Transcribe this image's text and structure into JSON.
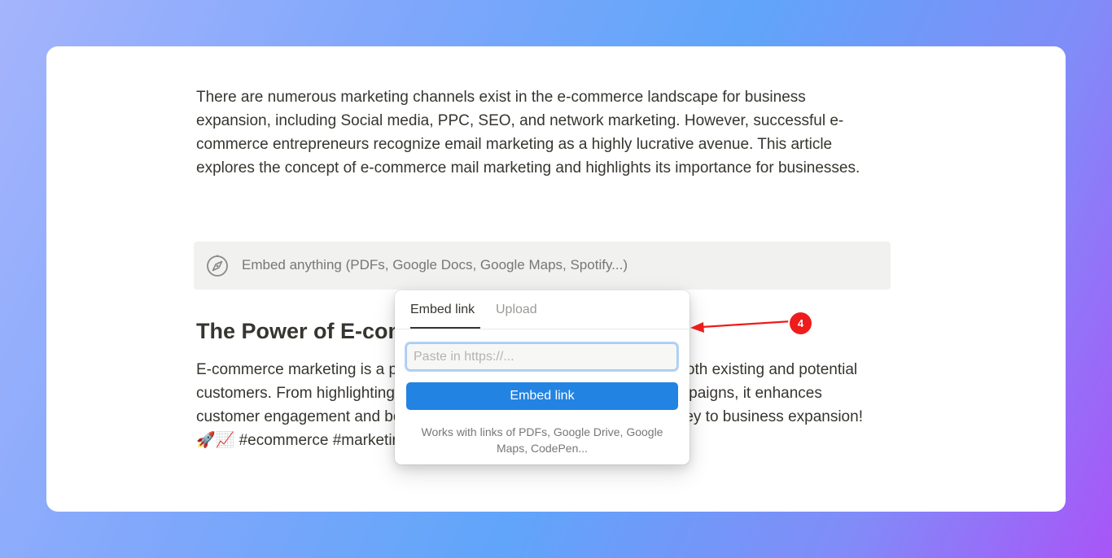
{
  "document": {
    "intro_paragraph": "There are numerous marketing channels exist in the e-commerce landscape for business expansion, including Social media, PPC, SEO, and network marketing. However, successful e-commerce entrepreneurs recognize email marketing as a highly lucrative avenue. This article explores the concept of e-commerce mail marketing and highlights its importance for businesses.",
    "embed_block": {
      "icon": "compass-icon",
      "placeholder": "Embed anything (PDFs, Google Docs, Google Maps, Spotify...)"
    },
    "heading": "The Power of E-commerce Marketing",
    "body_paragraph": "E-commerce marketing is a powerful strategy that allows you to reach both existing and potential customers. From highlighting featured products to using automated campaigns, it enhances customer engagement and boosts conversions. Don't miss out on this key to business expansion! 🚀📈 #ecommerce #marketing #businessgrowth"
  },
  "embed_popover": {
    "tabs": [
      {
        "label": "Embed link",
        "active": true
      },
      {
        "label": "Upload",
        "active": false
      }
    ],
    "input": {
      "value": "",
      "placeholder": "Paste in https://..."
    },
    "submit_label": "Embed link",
    "helper_text": "Works with links of PDFs, Google Drive, Google Maps, CodePen..."
  },
  "annotation": {
    "step_number": "4",
    "color": "#ee1c1c"
  },
  "colors": {
    "accent": "#2383e2",
    "text": "#37352f",
    "muted": "#787774"
  }
}
